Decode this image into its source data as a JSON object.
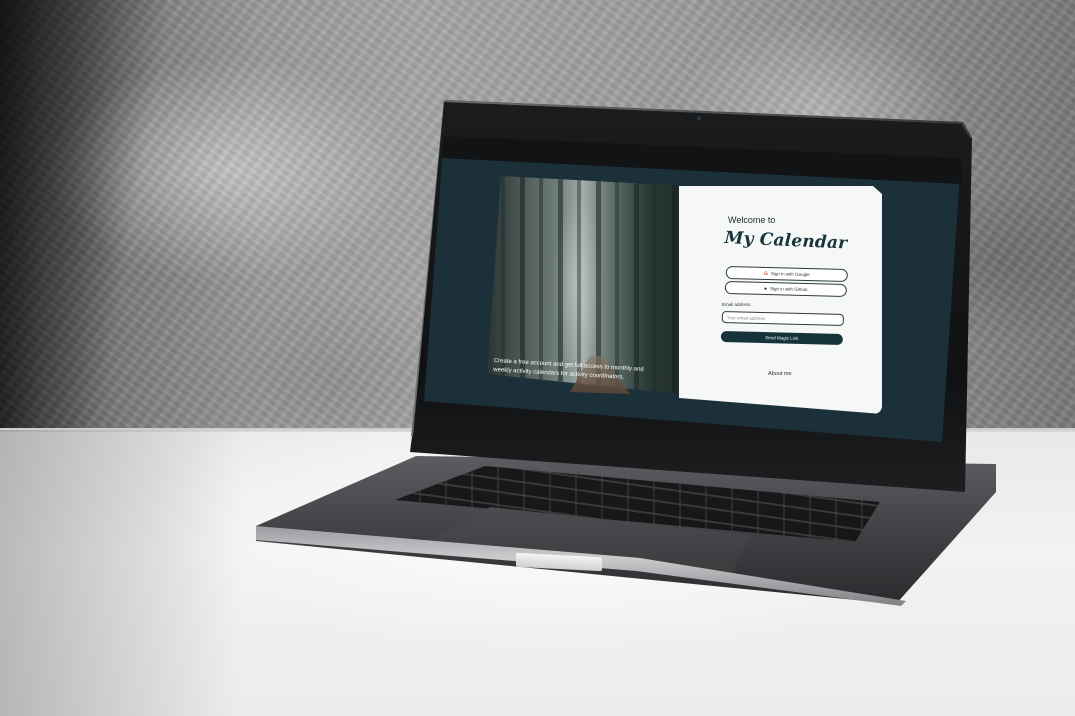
{
  "hero": {
    "caption": "Create a free account and get full access to monthly and weekly activity calendars for activity coordinators."
  },
  "login": {
    "welcome": "Welcome to",
    "brand": "My Calendar",
    "google_label": "Sign in with Google",
    "github_label": "Sign in with Github",
    "email_label": "Email address",
    "email_placeholder": "Your email address",
    "email_value": "",
    "magic_link_label": "Send Magic Link",
    "about_label": "About me"
  },
  "icons": {
    "google": "google-icon",
    "github": "github-icon"
  },
  "colors": {
    "screen_background": "#1b3038",
    "primary_button": "#17333a",
    "card_background": "#f6f7f7"
  }
}
